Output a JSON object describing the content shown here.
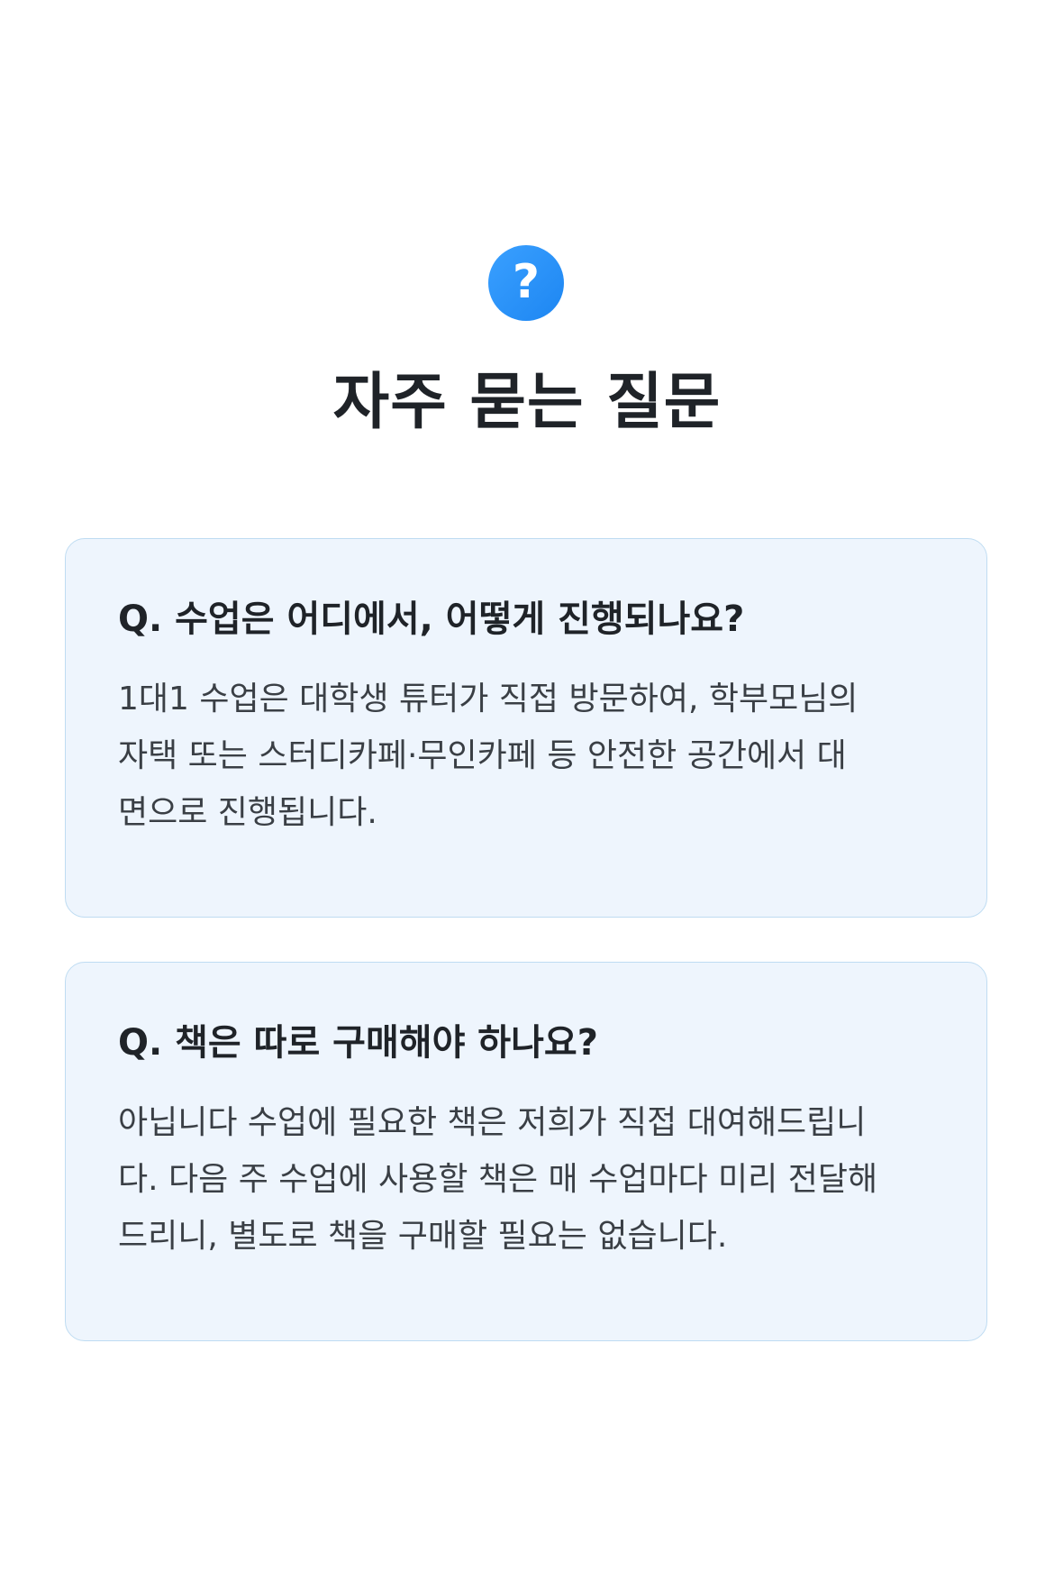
{
  "header": {
    "icon": "question-mark-icon",
    "icon_glyph": "?",
    "title": "자주 묻는 질문"
  },
  "faq": [
    {
      "question": "Q. 수업은 어디에서, 어떻게 진행되나요?",
      "answer": "1대1 수업은 대학생 튜터가 직접 방문하여, 학부모님의\n자택 또는 스터디카페·무인카페 등 안전한 공간에서 대\n면으로 진행됩니다."
    },
    {
      "question": "Q. 책은 따로 구매해야 하나요?",
      "answer": "아닙니다 수업에 필요한 책은 저희가 직접 대여해드립니\n다. 다음 주 수업에 사용할 책은 매 수업마다 미리 전달해\n드리니, 별도로 책을 구매할 필요는 없습니다."
    }
  ],
  "colors": {
    "accent": "#1d86f2",
    "card_background": "#eef5fd",
    "card_border": "#bfdcf2",
    "title_text": "#1f2328",
    "body_text": "#3a3f45"
  }
}
